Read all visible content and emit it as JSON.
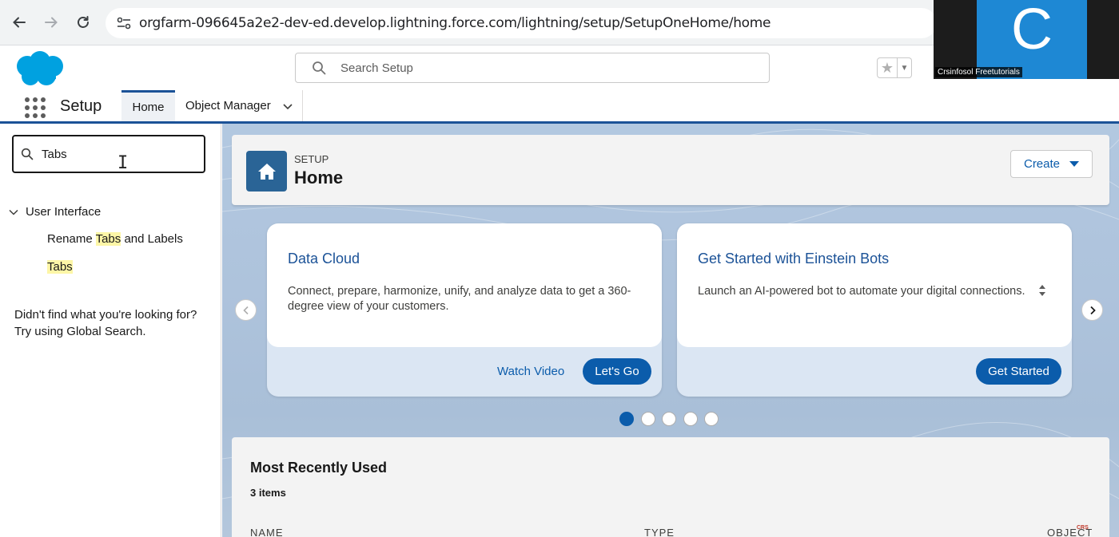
{
  "browser": {
    "url": "orgfarm-096645a2e2-dev-ed.develop.lightning.force.com/lightning/setup/SetupOneHome/home"
  },
  "webcam": {
    "letter": "C",
    "name": "Crsinfosol Freetutorials"
  },
  "header": {
    "search_placeholder": "Search Setup"
  },
  "context_bar": {
    "app_name": "Setup",
    "tabs": [
      {
        "label": "Home",
        "active": true
      },
      {
        "label": "Object Manager",
        "active": false
      }
    ]
  },
  "sidebar": {
    "quick_find_value": "Tabs",
    "section": "User Interface",
    "items": [
      {
        "pre": "Rename ",
        "highlight": "Tabs",
        "post": " and Labels"
      },
      {
        "pre": "",
        "highlight": "Tabs",
        "post": ""
      }
    ],
    "not_found_line1": "Didn't find what you're looking for?",
    "not_found_line2": "Try using Global Search."
  },
  "page_header": {
    "eyebrow": "SETUP",
    "title": "Home",
    "create_label": "Create"
  },
  "cards": [
    {
      "title": "Data Cloud",
      "description": "Connect, prepare, harmonize, unify, and analyze data to get a 360-degree view of your customers.",
      "link_label": "Watch Video",
      "button_label": "Let's Go"
    },
    {
      "title": "Get Started with Einstein Bots",
      "description": "Launch an AI-powered bot to automate your digital connections.",
      "button_label": "Get Started"
    }
  ],
  "carousel": {
    "page_count": 5,
    "active_index": 0
  },
  "mru": {
    "title": "Most Recently Used",
    "count": "3 items",
    "columns": [
      "NAME",
      "TYPE",
      "OBJECT"
    ]
  },
  "watermark": "CRS",
  "colors": {
    "brand_blue": "#0b5cab",
    "header_icon_bg": "#2a6496",
    "highlight": "#fdf6a7",
    "salesforce_cloud": "#00a1e0"
  }
}
